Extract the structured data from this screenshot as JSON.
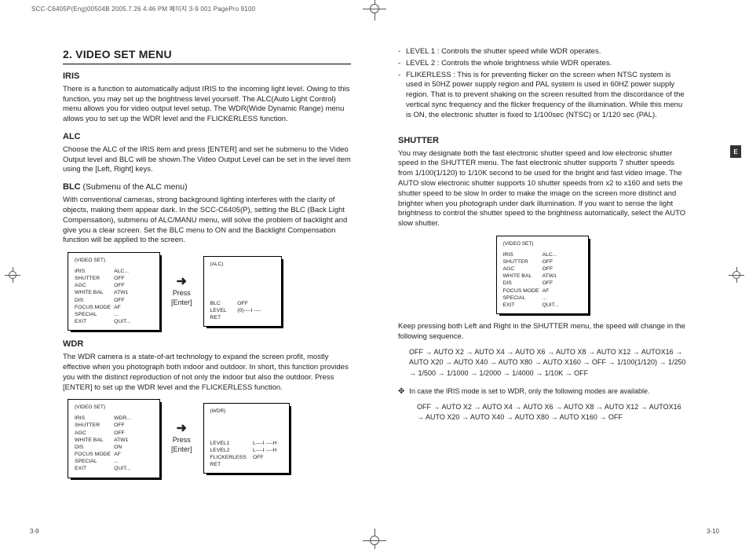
{
  "meta": {
    "header": "SCC-C6405P(Eng)00504B  2005.7.26 4:46 PM  페이지 3-9   001 PagePro 9100",
    "side_tab": "E",
    "footer_left": "3-9",
    "footer_right": "3-10"
  },
  "left": {
    "section_title": "2. VIDEO SET MENU",
    "iris": {
      "heading": "IRIS",
      "body": "There is a function to automatically adjust IRIS to the incoming light level. Owing to this function, you may set up the brightness level yourself. The ALC(Auto Light Control) menu allows you for video output level setup. The WDR(Wide Dynamic Range) menu allows you to set up the WDR level and the FLICKERLESS function."
    },
    "alc": {
      "heading": "ALC",
      "body": "Choose the ALC of the IRIS item and press [ENTER] and set he submenu to the Video Output level and BLC will be shown.The Video Output Level can be set in the level item using the [Left, Right] keys."
    },
    "blc": {
      "heading": "BLC",
      "heading_paren": " (Submenu of the ALC menu)",
      "body": "With conventional cameras, strong background lighting interferes with the clarity of objects, making them appear dark.  In the SCC-C6405(P), setting the BLC (Back Light Compensation), submenu of ALC/MANU menu, will solve the problem of backlight and give you a clear screen. Set the BLC menu to ON and the Backlight Compensation function will be applied to the screen."
    },
    "press_label": "Press\n[Enter]",
    "osd_videoset": {
      "title": "(VIDEO SET)",
      "rows": [
        [
          "IRIS",
          "ALC..."
        ],
        [
          "SHUTTER",
          "OFF"
        ],
        [
          "AGC",
          "OFF"
        ],
        [
          "WHITE BAL",
          "ATW1"
        ],
        [
          "DIS",
          "OFF"
        ],
        [
          "FOCUS MODE",
          "AF"
        ],
        [
          "SPECIAL",
          "..."
        ],
        [
          "EXIT",
          "QUIT..."
        ]
      ]
    },
    "osd_alc": {
      "title": "(ALC)",
      "rows": [
        [
          "BLC",
          "OFF"
        ],
        [
          "LEVEL",
          "(0)----I ----"
        ],
        [
          "RET",
          ""
        ]
      ]
    },
    "wdr": {
      "heading": "WDR",
      "body": "The WDR camera is a state-of-art technology to expand the screen profit, mostly effective when you photograph both indoor and outdoor. In short, this function provides you with the distinct reproduction of not only the indoor but also the outdoor. Press [ENTER] to set up the WDR level and the FLICKERLESS function."
    },
    "osd_videoset_wdr": {
      "title": "(VIDEO SET)",
      "rows": [
        [
          "IRIS",
          "WDR..."
        ],
        [
          "SHUTTER",
          "OFF"
        ],
        [
          "AGC",
          "OFF"
        ],
        [
          "WHITE BAL",
          "ATW1"
        ],
        [
          "DIS",
          "ON"
        ],
        [
          "FOCUS MODE",
          "AF"
        ],
        [
          "SPECIAL",
          "..."
        ],
        [
          "EXIT",
          "QUIT..."
        ]
      ]
    },
    "osd_wdr": {
      "title": "(WDR)",
      "rows": [
        [
          "LEVEL1",
          "L----I ----H"
        ],
        [
          "LEVEL2",
          "L----I ----H"
        ],
        [
          "FLICKERLESS",
          "OFF"
        ],
        [
          "RET",
          ""
        ]
      ]
    }
  },
  "right": {
    "bullets": [
      "LEVEL 1 : Controls the shutter speed while WDR operates.",
      "LEVEL 2 : Controls the whole brightness while WDR operates.",
      "FLIKERLESS : This is for preventing flicker on the screen when NTSC system is used in 50HZ power supply region and PAL system is used in 60HZ power supply region. That is to prevent shaking on the screen resulted from the discordance of the vertical sync frequency and the flicker frequency of the illumination. While this menu is ON, the electronic shutter is fixed to 1/100sec (NTSC) or 1/120 sec (PAL)."
    ],
    "shutter": {
      "heading": "SHUTTER",
      "body": "You may designate both the fast electronic shutter speed and low electronic shutter speed in the SHUTTER menu. The fast electronic shutter supports 7 shutter speeds from 1/100(1/120)  to 1/10K second to be used for the bright and fast video image. The AUTO slow electronic shutter supports 10 shutter speeds from x2 to x160 and sets the shutter speed to be slow In order to make the image on the screen more distinct and brighter when you photograph under dark illumination. If you want to sense the light brightness to control the shutter speed to the brightness automatically, select the AUTO slow shutter."
    },
    "osd_videoset": {
      "title": "(VIDEO SET)",
      "rows": [
        [
          "IRIS",
          "ALC..."
        ],
        [
          "SHUTTER",
          "OFF"
        ],
        [
          "AGC",
          "OFF"
        ],
        [
          "WHITE BAL",
          "ATW1"
        ],
        [
          "DIS",
          "OFF"
        ],
        [
          "FOCUS MODE",
          "AF"
        ],
        [
          "SPECIAL",
          "..."
        ],
        [
          "EXIT",
          "QUIT..."
        ]
      ]
    },
    "keep_pressing": "Keep pressing both Left and Right in the SHUTTER menu, the speed will change in the following sequence.",
    "seq1": "OFF → AUTO X2 → AUTO X4 → AUTO X6 → AUTO X8 → AUTO X12 → AUTOX16 → AUTO X20 → AUTO X40 → AUTO X80 → AUTO X160 → OFF → 1/100(1/120) → 1/250 → 1/500 → 1/1000 → 1/2000 → 1/4000 → 1/10K → OFF",
    "note": {
      "mark": "✥",
      "text": "In case the IRIS mode is set to WDR, only the following modes are available."
    },
    "seq2": "OFF → AUTO X2 → AUTO X4 → AUTO X6 → AUTO X8 → AUTO X12 → AUTOX16 → AUTO X20 → AUTO X40 → AUTO X80 → AUTO X160 → OFF"
  }
}
